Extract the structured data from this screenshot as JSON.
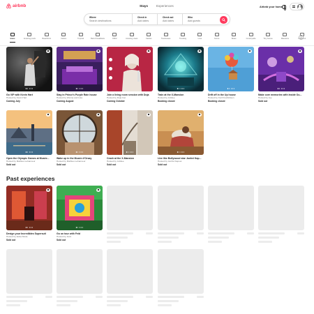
{
  "header": {
    "logo_text": "airbnb",
    "tabs": [
      {
        "label": "Stays",
        "active": true
      },
      {
        "label": "Experiences",
        "active": false
      }
    ],
    "host_link": "Airbnb your home",
    "icons": [
      "globe-icon",
      "menu-icon",
      "avatar"
    ]
  },
  "search": {
    "where_label": "Where",
    "where_value": "Search destinations",
    "checkin_label": "Check in",
    "checkin_value": "Add dates",
    "checkout_label": "Check out",
    "checkout_value": "Add dates",
    "who_label": "Who",
    "who_value": "Add guests",
    "button_icon": "search-icon"
  },
  "categories": [
    "Icons",
    "Amazing pools",
    "Beachfront",
    "Cabins",
    "Tropical",
    "Bed & breakfasts",
    "OMG!",
    "Amazing views",
    "Castles",
    "Treehouses",
    "Trending",
    "Luxe",
    "Farms",
    "Boats",
    "Countryside",
    "Tiny homes",
    "Mansions",
    "Lakefront"
  ],
  "active_category": "Icons",
  "icons_cards": [
    {
      "title": "Go VIP with Kevin Hart",
      "host": "Hosted by Kevin Hart",
      "status": "Coming July"
    },
    {
      "title": "Stay in Prince's Purple Rain house",
      "host": "Hosted by Wendy and Lisa",
      "status": "Coming August"
    },
    {
      "title": "Join a living room session with Doja",
      "host": "Hosted by Doja Cat",
      "status": "Coming October"
    },
    {
      "title": "Train at the X-Mansion",
      "host": "Hosted by Jubilee",
      "status": "Booking closed"
    },
    {
      "title": "Drift off in the Up house",
      "host": "Hosted by Carl Fredricksen",
      "status": "Booking closed"
    },
    {
      "title": "Make core memories with Inside Ou...",
      "host": "Hosted by Joy",
      "status": "Sold out"
    },
    {
      "title": "Open the Olympic Games at Musée...",
      "host": "Hosted by Mathieu Lehanneur",
      "status": "Sold out"
    },
    {
      "title": "Wake up in the Musée d'Orsay",
      "host": "Hosted by Mathieu Lehanneur",
      "status": "Sold out"
    },
    {
      "title": "Crash at the X-Mansion",
      "host": "Hosted by Jubilee",
      "status": "Sold out"
    },
    {
      "title": "Live like Bollywood star Janhvi Kap...",
      "host": "Hosted by Janhvi Kapoor",
      "status": "Sold out"
    }
  ],
  "past_section_title": "Past experiences",
  "past_cards": [
    {
      "title": "Design your Incredibles Supersuit",
      "host": "Hosted by Edna Mode",
      "status": "Sold out"
    },
    {
      "title": "Go on tour with Feid",
      "host": "Hosted by Feid",
      "status": "Sold out"
    }
  ],
  "colors": {
    "brand": "#ff385c",
    "text": "#222222",
    "muted": "#717171",
    "skeleton": "#ececec"
  }
}
